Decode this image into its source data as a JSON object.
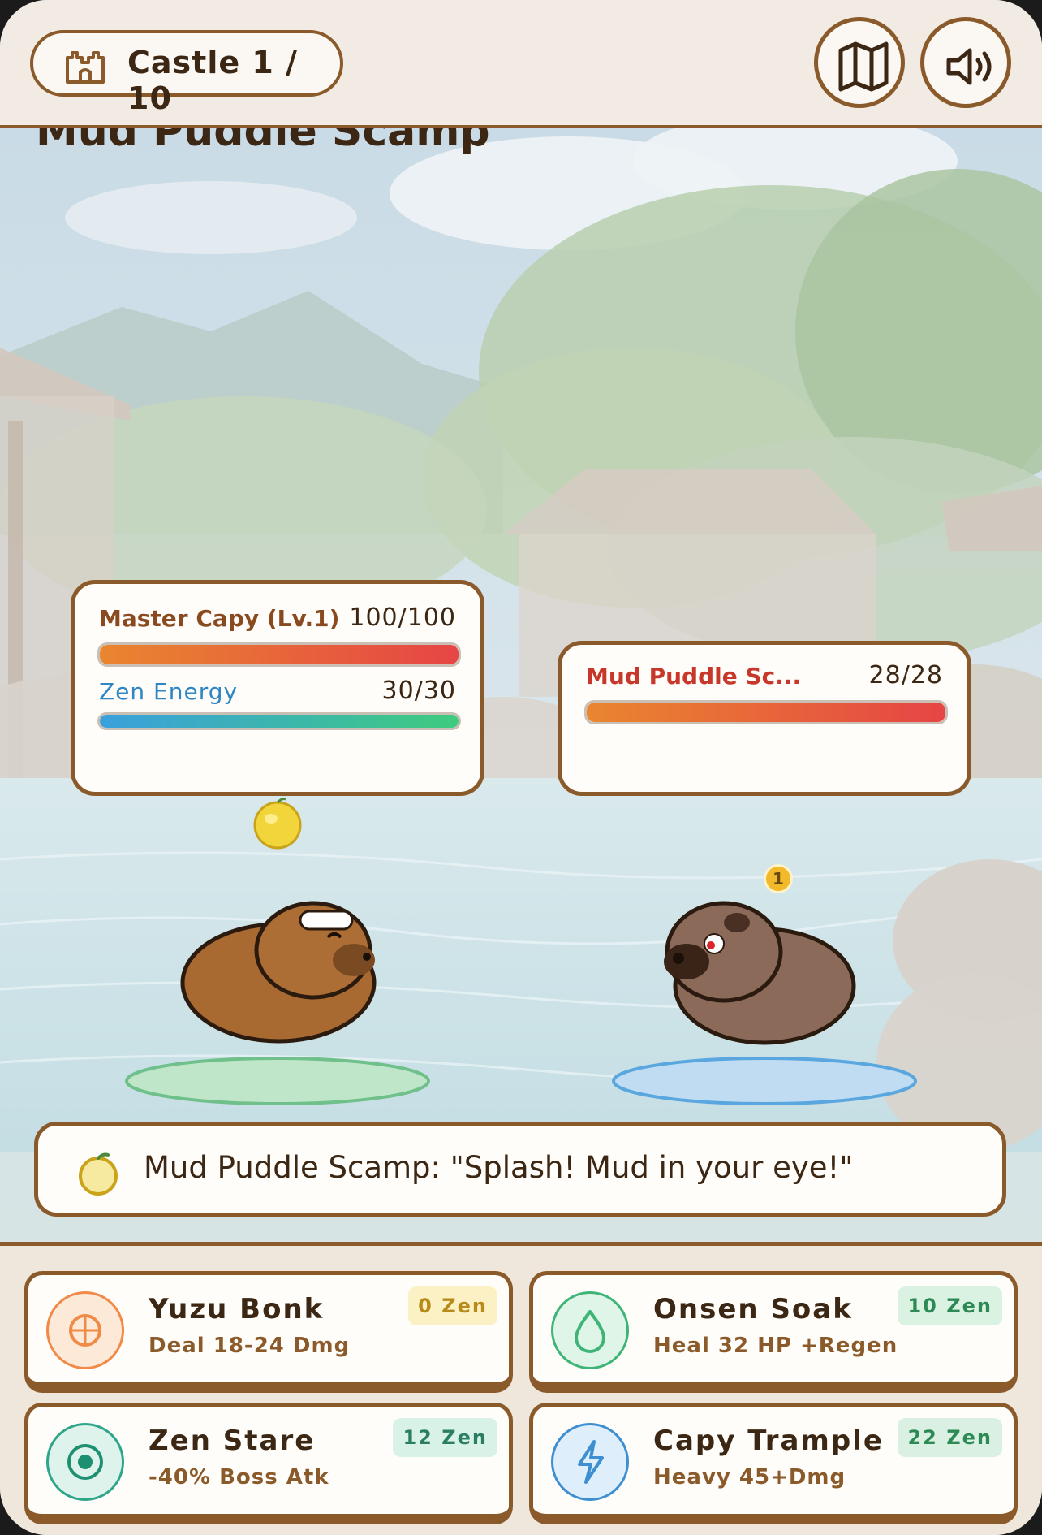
{
  "topbar": {
    "castle_label": "Castle 1 / 10",
    "map_icon": "map-icon",
    "sound_icon": "speaker-icon"
  },
  "boss_title": "Mud Puddle Scamp",
  "player": {
    "name": "Master Capy (Lv.1)",
    "hp_text": "100/100",
    "hp_fraction": 1.0,
    "energy_label": "Zen Energy",
    "energy_text": "30/30",
    "energy_fraction": 1.0
  },
  "enemy": {
    "name": "Mud Puddle Sc...",
    "hp_text": "28/28",
    "hp_fraction": 1.0,
    "status_badge": "1"
  },
  "dialog": {
    "icon": "yuzu-icon",
    "text": "Mud Puddle Scamp: \"Splash! Mud in your eye!\""
  },
  "moves": [
    {
      "name": "Yuzu Bonk",
      "desc": "Deal 18-24 Dmg",
      "cost": "0 Zen",
      "icon": "yuzu-icon"
    },
    {
      "name": "Onsen Soak",
      "desc": "Heal 32 HP +Regen",
      "cost": "10 Zen",
      "icon": "droplet-icon"
    },
    {
      "name": "Zen Stare",
      "desc": "-40% Boss Atk",
      "cost": "12 Zen",
      "icon": "target-icon"
    },
    {
      "name": "Capy Trample",
      "desc": "Heavy 45+Dmg",
      "cost": "22 Zen",
      "icon": "lightning-icon"
    }
  ],
  "colors": {
    "accent_brown": "#8a5a2b",
    "hp_start": "#e9862f",
    "hp_end": "#e64545",
    "energy_start": "#3aa0dd",
    "energy_end": "#3ecb7e"
  }
}
